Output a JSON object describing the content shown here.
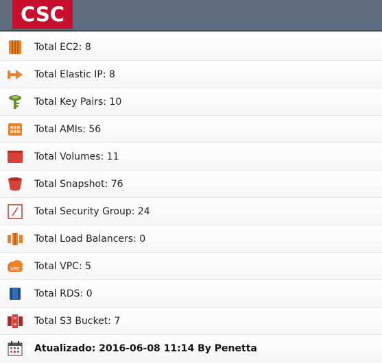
{
  "header": {
    "logo_text": "CSC",
    "background_color": "#5e6e7e",
    "logo_color": "#c8102e"
  },
  "items": [
    {
      "label": "Total EC2: 8",
      "icon": "ec2-icon"
    },
    {
      "label": "Total Elastic IP: 8",
      "icon": "elastic-ip-icon"
    },
    {
      "label": "Total Key Pairs: 10",
      "icon": "key-pair-icon"
    },
    {
      "label": "Total AMIs: 56",
      "icon": "ami-icon"
    },
    {
      "label": "Total Volumes: 11",
      "icon": "volume-icon"
    },
    {
      "label": "Total Snapshot: 76",
      "icon": "snapshot-icon"
    },
    {
      "label": "Total Security Group: 24",
      "icon": "security-group-icon"
    },
    {
      "label": "Total Load Balancers: 0",
      "icon": "load-balancer-icon"
    },
    {
      "label": "Total VPC: 5",
      "icon": "vpc-icon"
    },
    {
      "label": "Total RDS: 0",
      "icon": "rds-icon"
    },
    {
      "label": "Total S3 Bucket: 7",
      "icon": "s3-bucket-icon"
    }
  ],
  "footer": {
    "label": "Atualizado: 2016-06-08 11:14 By Penetta",
    "icon": "calendar-icon"
  }
}
